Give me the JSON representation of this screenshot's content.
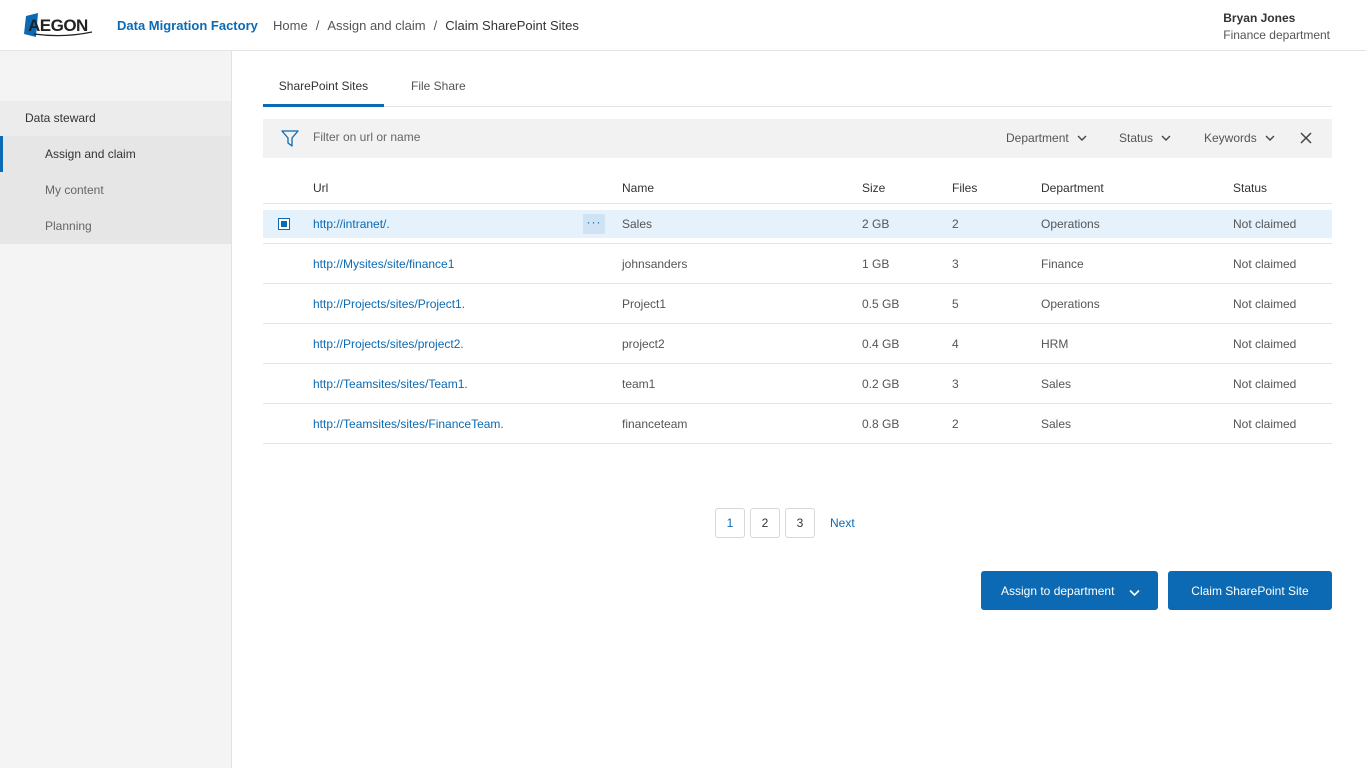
{
  "header": {
    "logo_text": "AEGON",
    "app_title": "Data Migration Factory",
    "breadcrumb": [
      "Home",
      "Assign and claim",
      "Claim SharePoint Sites"
    ],
    "user": {
      "name": "Bryan Jones",
      "department": "Finance department"
    }
  },
  "sidebar": {
    "heading": "Data steward",
    "items": [
      {
        "label": "Assign and claim",
        "active": true
      },
      {
        "label": "My content",
        "active": false
      },
      {
        "label": "Planning",
        "active": false
      }
    ]
  },
  "tabs": [
    {
      "label": "SharePoint Sites",
      "active": true
    },
    {
      "label": "File Share",
      "active": false
    }
  ],
  "filter": {
    "placeholder": "Filter on url or name",
    "dropdowns": [
      "Department",
      "Status",
      "Keywords"
    ]
  },
  "table": {
    "columns": [
      "Url",
      "Name",
      "Size",
      "Files",
      "Department",
      "Status"
    ],
    "rows": [
      {
        "url": "http://intranet/.",
        "name": "Sales",
        "size": "2 GB",
        "files": "2",
        "department": "Operations",
        "status": "Not claimed",
        "selected": true
      },
      {
        "url": "http://Mysites/site/finance1",
        "name": "johnsanders",
        "size": "1 GB",
        "files": "3",
        "department": "Finance",
        "status": "Not claimed"
      },
      {
        "url": "http://Projects/sites/Project1.",
        "name": "Project1",
        "size": "0.5 GB",
        "files": "5",
        "department": "Operations",
        "status": "Not claimed"
      },
      {
        "url": "http://Projects/sites/project2.",
        "name": "project2",
        "size": "0.4 GB",
        "files": "4",
        "department": "HRM",
        "status": "Not claimed"
      },
      {
        "url": "http://Teamsites/sites/Team1.",
        "name": "team1",
        "size": "0.2 GB",
        "files": "3",
        "department": "Sales",
        "status": "Not claimed"
      },
      {
        "url": "http://Teamsites/sites/FinanceTeam.",
        "name": "financeteam",
        "size": "0.8 GB",
        "files": "2",
        "department": "Sales",
        "status": "Not claimed"
      }
    ],
    "row_menu_label": "···"
  },
  "pagination": {
    "pages": [
      "1",
      "2",
      "3"
    ],
    "current": "1",
    "next_label": "Next"
  },
  "actions": {
    "assign_label": "Assign to department",
    "claim_label": "Claim SharePoint Site"
  },
  "colors": {
    "accent": "#0b6ab3",
    "selected_row": "#e5f1fb",
    "sidebar_bg": "#f4f4f4"
  },
  "icons": [
    "filter-icon",
    "chevron-down-icon",
    "close-icon",
    "more-icon",
    "checkbox-icon"
  ]
}
